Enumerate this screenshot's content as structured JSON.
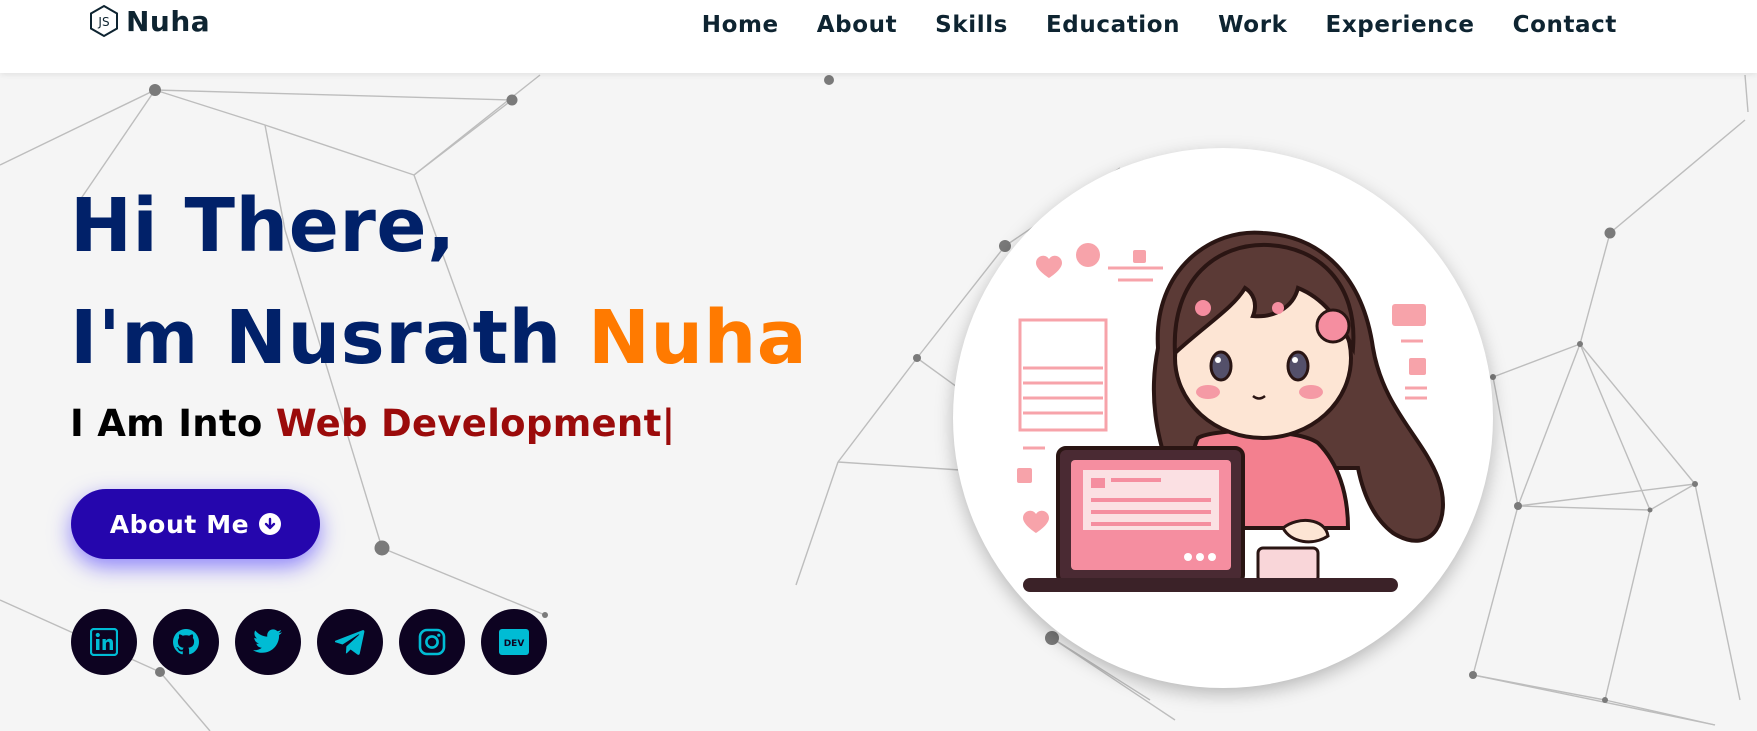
{
  "header": {
    "logo_text": "Nuha",
    "logo_icon": "js-hexagon-icon",
    "nav": [
      "Home",
      "About",
      "Skills",
      "Education",
      "Work",
      "Experience",
      "Contact"
    ]
  },
  "hero": {
    "line1": "Hi There,",
    "line2_prefix": "I'm Nusrath ",
    "line2_accent": "Nuha",
    "typing_prefix": "I Am Into ",
    "typing_role": "Web Development|",
    "button_label": "About Me",
    "button_icon": "arrow-down-circle-icon"
  },
  "socials": [
    {
      "icon": "linkedin-icon"
    },
    {
      "icon": "github-icon"
    },
    {
      "icon": "twitter-icon"
    },
    {
      "icon": "telegram-icon"
    },
    {
      "icon": "instagram-icon"
    },
    {
      "icon": "dev-icon",
      "label": "DEV"
    }
  ],
  "colors": {
    "heading": "#012169",
    "accent": "#ff7a00",
    "role": "#9b0b0b",
    "button": "#2506ad",
    "social_bg": "#0d0321",
    "social_icon": "#00bcd4"
  }
}
